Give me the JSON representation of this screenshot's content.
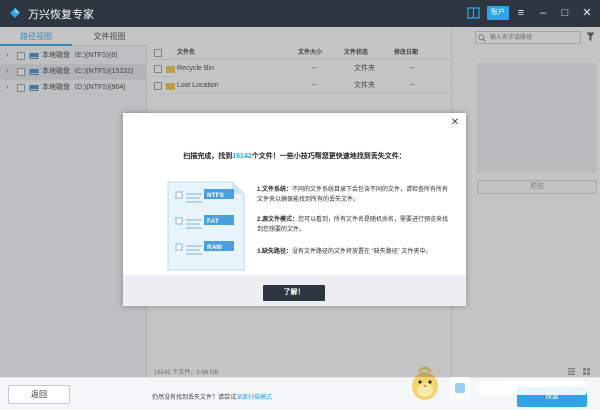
{
  "app": {
    "title": "万兴恢复专家",
    "account_label": "账户",
    "icons": {
      "logo": "app-logo-icon",
      "guide": "book-icon",
      "menu": "menu-icon",
      "minimize": "minimize-icon",
      "maximize": "maximize-icon",
      "close": "close-icon"
    },
    "accent_color": "#2fa4ea",
    "titlebar_color": "#2e3642"
  },
  "left_panel": {
    "tabs": [
      {
        "label": "路径视图",
        "active": true
      },
      {
        "label": "文件视图",
        "active": false
      }
    ],
    "drives": [
      {
        "label": "本地磁盘（E:)(NTFS)(6)"
      },
      {
        "label": "本地磁盘（C:)(NTFS)(15232)"
      },
      {
        "label": "本地磁盘（D:)(NTFS)(904)"
      }
    ]
  },
  "file_list": {
    "columns": [
      "文件名",
      "文件大小",
      "文件状态",
      "修改日期"
    ],
    "rows": [
      {
        "name": "Recycle Bin",
        "size": "--",
        "status": "文件夹",
        "date": "--"
      },
      {
        "name": "Lost Location",
        "size": "--",
        "status": "文件夹",
        "date": "--"
      }
    ],
    "status_text": "16142 个文件，2.68 GB"
  },
  "right_panel": {
    "search_placeholder": "输入名字或路径",
    "preview_label": "预览"
  },
  "bottom_bar": {
    "back_label": "返回",
    "hint_text": "仍然没有找到丢失文件？请尝试",
    "hint_link": "深度扫描模式",
    "recover_label": "恢复"
  },
  "dialog": {
    "headline_prefix": "扫描完成，找到",
    "file_count": "16142",
    "headline_suffix": "个文件！一些小技巧帮您更快速地找到丢失文件：",
    "illustration_tags": [
      "NTFS",
      "FAT",
      "RAW"
    ],
    "tips": [
      {
        "title": "1.文件系统：",
        "text": "不同的文件系统目录下会包含不同的文件，请检查所有所有文件夹以确保能找到所有的丢失文件。"
      },
      {
        "title": "2.源文件模式：",
        "text": "您可以看到，所有文件名是随机命名，需要进行预览来找到您想要的文件。"
      },
      {
        "title": "3.缺失路径：",
        "text": "没有文件路径的文件将放置在 “缺失路径” 文件夹中。"
      }
    ],
    "ok_label": "了解！"
  }
}
